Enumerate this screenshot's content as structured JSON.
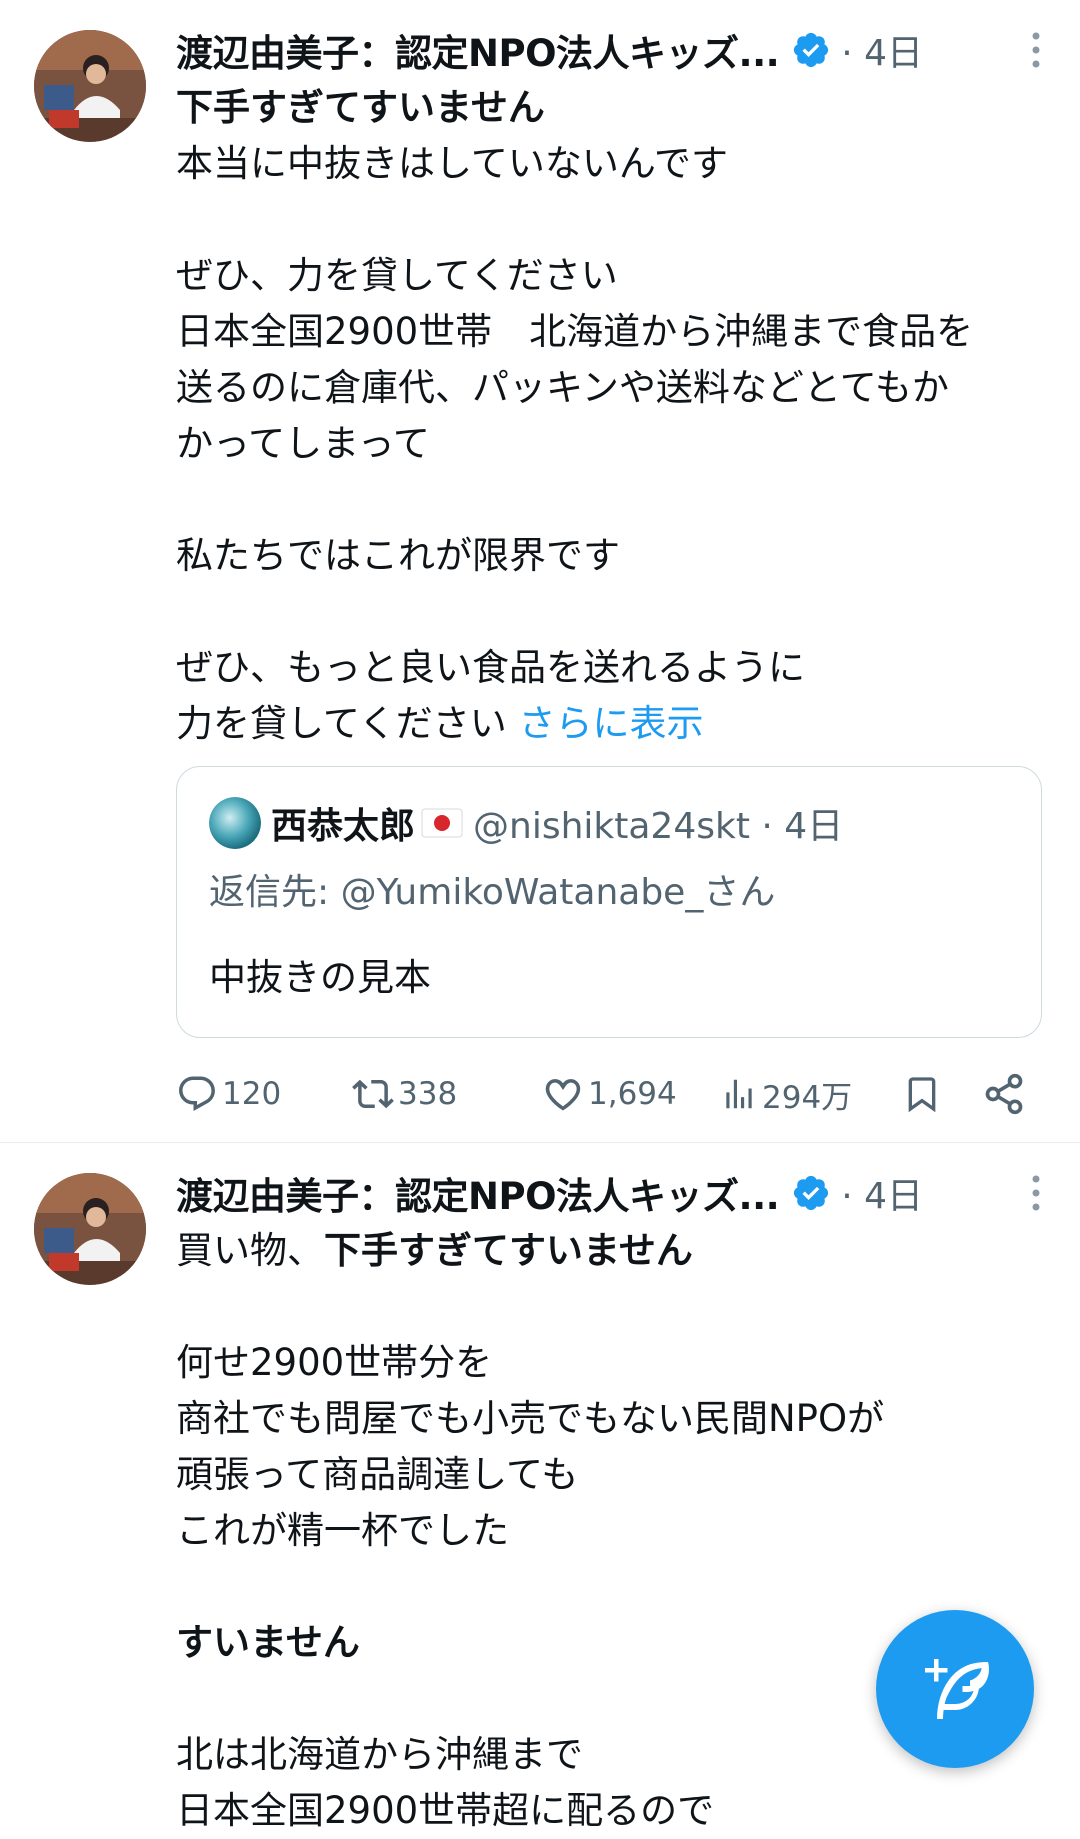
{
  "tweet1": {
    "author_name": "渡辺由美子：認定NPO法人キッズ...",
    "time": "· 4日",
    "lines": [
      {
        "text": "下手すぎてすいません",
        "bold": true
      },
      {
        "text": "本当に中抜きはしていないんです"
      },
      {
        "text": ""
      },
      {
        "text": "ぜひ、力を貸してください"
      },
      {
        "text": "日本全国2900世帯　北海道から沖縄まで食品を"
      },
      {
        "text": "送るのに倉庫代、パッキンや送料などとてもか"
      },
      {
        "text": "かってしまって"
      },
      {
        "text": ""
      },
      {
        "text": "私たちではこれが限界です"
      },
      {
        "text": ""
      },
      {
        "text": "ぜひ、もっと良い食品を送れるように"
      }
    ],
    "last_line": "力を貸してください",
    "show_more": "さらに表示",
    "quote": {
      "name": "西恭太郎",
      "handle": "@nishikta24skt · 4日",
      "reply_to": "返信先: @YumikoWatanabe_さん",
      "text": "中抜きの見本"
    },
    "stats": {
      "replies": "120",
      "retweets": "338",
      "likes": "1,694",
      "views": "294万"
    }
  },
  "tweet2": {
    "author_name": "渡辺由美子：認定NPO法人キッズ...",
    "time": "· 4日",
    "first_line_plain": "買い物、",
    "first_line_bold": "下手すぎてすいません",
    "lines": [
      {
        "text": ""
      },
      {
        "text": "何せ2900世帯分を"
      },
      {
        "text": "商社でも問屋でも小売でもない民間NPOが"
      },
      {
        "text": "頑張って商品調達しても"
      },
      {
        "text": "これが精一杯でした"
      },
      {
        "text": ""
      },
      {
        "text": "すいません",
        "bold": true
      },
      {
        "text": ""
      },
      {
        "text": "北は北海道から沖縄まで"
      },
      {
        "text": "日本全国2900世帯超に配るので"
      }
    ]
  },
  "colors": {
    "accent": "#1d9bf0",
    "muted": "#536471",
    "border": "#cfd9de"
  },
  "icons": [
    "verified-badge-icon",
    "more-icon",
    "reply-icon",
    "retweet-icon",
    "like-icon",
    "views-icon",
    "bookmark-icon",
    "share-icon",
    "compose-icon",
    "japan-flag-icon"
  ]
}
